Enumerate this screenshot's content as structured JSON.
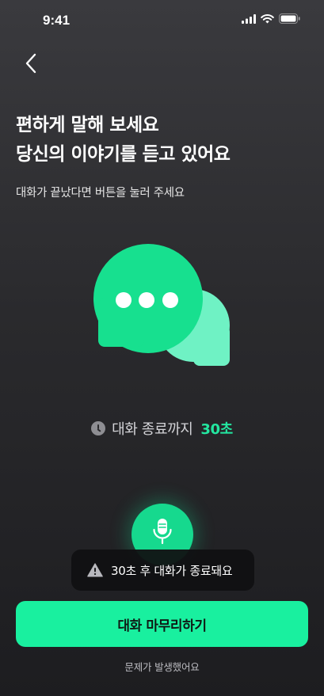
{
  "status_bar": {
    "time": "9:41",
    "icons": [
      "signal-icon",
      "wifi-icon",
      "battery-icon"
    ]
  },
  "nav": {
    "back_icon": "chevron-left-icon"
  },
  "headline": {
    "line1": "편하게 말해 보세요",
    "line2": "당신의 이야기를 듣고 있어요"
  },
  "subtext": "대화가 끝났다면 버튼을 눌러 주세요",
  "illustration": {
    "icon": "chat-bubbles-icon",
    "colors": {
      "front": "#17e08f",
      "back": "#6ff2c4",
      "dots": "#ffffff"
    }
  },
  "timer": {
    "icon": "clock-icon",
    "label": "대화 종료까지",
    "value": "30초"
  },
  "mic": {
    "icon": "microphone-icon"
  },
  "toast": {
    "icon": "warning-icon",
    "text": "30초 후 대화가 종료돼요"
  },
  "actions": {
    "finish_label": "대화 마무리하기",
    "problem_label": "문제가 발생했어요"
  },
  "colors": {
    "accent": "#19f09f",
    "timer_value": "#23e6a0"
  }
}
